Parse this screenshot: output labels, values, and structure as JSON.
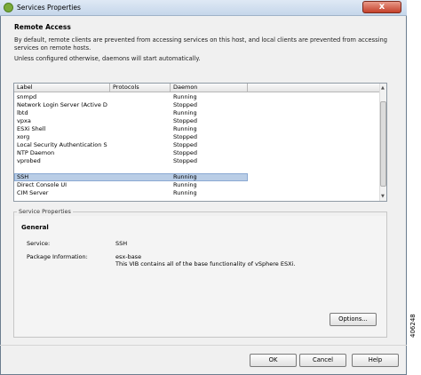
{
  "window": {
    "title": "Services Properties",
    "close_glyph": "x"
  },
  "remote_access": {
    "title": "Remote Access",
    "desc1": "By default, remote clients are prevented from accessing services on this host, and local clients are prevented from accessing services on remote hosts.",
    "desc2": "Unless configured otherwise, daemons will start automatically."
  },
  "table": {
    "columns": [
      "Label",
      "Protocols",
      "Daemon"
    ],
    "rows": [
      {
        "label": "snmpd",
        "protocols": "",
        "daemon": "Running"
      },
      {
        "label": "Network Login Server (Active Di...",
        "protocols": "",
        "daemon": "Stopped"
      },
      {
        "label": "lbtd",
        "protocols": "",
        "daemon": "Running"
      },
      {
        "label": "vpxa",
        "protocols": "",
        "daemon": "Stopped"
      },
      {
        "label": "ESXi Shell",
        "protocols": "",
        "daemon": "Running"
      },
      {
        "label": "xorg",
        "protocols": "",
        "daemon": "Stopped"
      },
      {
        "label": "Local Security Authentication Se...",
        "protocols": "",
        "daemon": "Stopped"
      },
      {
        "label": "NTP Daemon",
        "protocols": "",
        "daemon": "Stopped"
      },
      {
        "label": "vprobed",
        "protocols": "",
        "daemon": "Stopped"
      },
      {
        "label": "SSH",
        "protocols": "",
        "daemon": "Running",
        "selected": true
      },
      {
        "label": "Direct Console UI",
        "protocols": "",
        "daemon": "Running"
      },
      {
        "label": "CIM Server",
        "protocols": "",
        "daemon": "Running"
      }
    ]
  },
  "service_properties": {
    "group_label": "Service Properties",
    "general_title": "General",
    "service_label": "Service:",
    "service_value": "SSH",
    "package_label": "Package Information:",
    "package_name": "esx-base",
    "package_desc": "This VIB contains all of the base functionality of vSphere ESXi.",
    "options_button": "Options..."
  },
  "footer": {
    "ok": "OK",
    "cancel": "Cancel",
    "help": "Help"
  },
  "figure_id": "406248"
}
